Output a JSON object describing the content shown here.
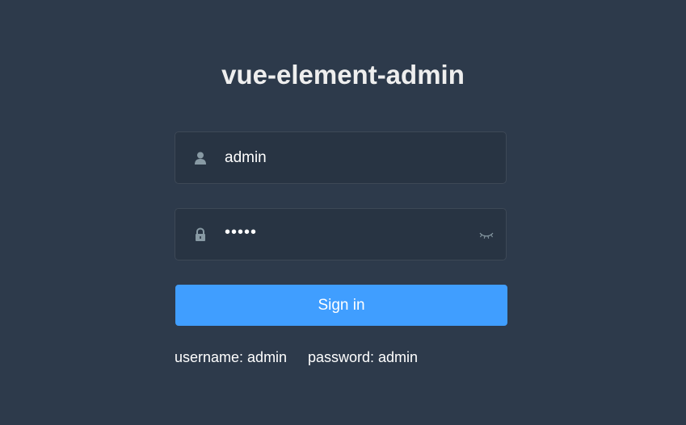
{
  "title": "vue-element-admin",
  "username_field": {
    "value": "admin",
    "icon": "user-icon"
  },
  "password_field": {
    "value": "•••••",
    "icon": "lock-icon",
    "toggle_icon": "eye-closed-icon"
  },
  "signin_button": {
    "label": "Sign in"
  },
  "tips": {
    "username": "username: admin",
    "password": "password: admin"
  },
  "colors": {
    "background": "#2d3a4b",
    "field_bg": "#283443",
    "button": "#409eff",
    "icon": "#889aa4"
  }
}
